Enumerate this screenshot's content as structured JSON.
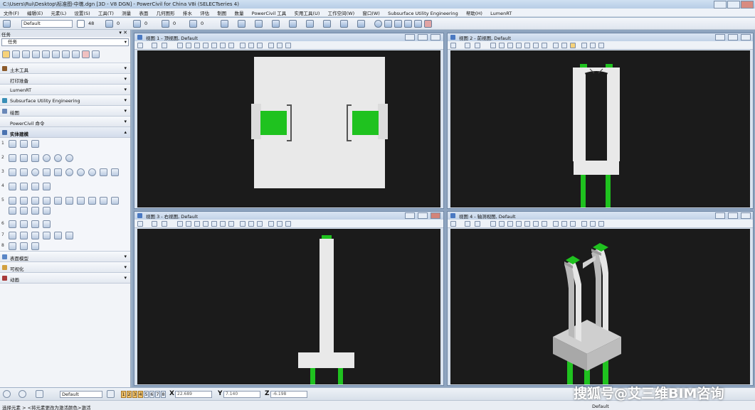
{
  "window": {
    "title": "C:\\Users\\Rui\\Desktop\\标准图-中墩.dgn [3D - V8 DGN] - PowerCivil for China V8i (SELECTseries 4)"
  },
  "menu": [
    "文件(F)",
    "编辑(E)",
    "元素(L)",
    "设置(S)",
    "工具(T)",
    "测量",
    "表面",
    "几何图形",
    "排水",
    "评估",
    "制图",
    "数量",
    "PowerCivil 工具",
    "实用工具(U)",
    "工作空间(W)",
    "窗口(W)",
    "Subsurface Utility Engineering",
    "帮助(H)",
    "LumenRT"
  ],
  "toolbar": {
    "level": "Default",
    "weight": "48",
    "style1": "0",
    "style2": "0",
    "style3": "0",
    "style4": "0"
  },
  "task_panel": {
    "title": "任务",
    "combo": "任务",
    "sections_top": [
      {
        "label": "土木工具",
        "icon": "civil-tools-icon"
      },
      {
        "label": "打印准备",
        "icon": "print-icon"
      },
      {
        "label": "LumenRT",
        "icon": "lumenrt-icon"
      },
      {
        "label": "Subsurface Utility Engineering",
        "icon": "sue-icon"
      },
      {
        "label": "绘图",
        "icon": "drawing-icon"
      },
      {
        "label": "PowerCivil 命令",
        "icon": "powercivil-icon"
      }
    ],
    "solid_section": {
      "label": "实体建模"
    },
    "solid_rows": [
      "1",
      "2",
      "3",
      "4",
      "5",
      "6",
      "7",
      "8"
    ],
    "sections_bottom": [
      {
        "label": "表面模型"
      },
      {
        "label": "可视化"
      },
      {
        "label": "动画"
      }
    ]
  },
  "views": [
    {
      "title": "视图 1 - 顶视图, Default"
    },
    {
      "title": "视图 2 - 前视图, Default"
    },
    {
      "title": "视图 3 - 右视图, Default"
    },
    {
      "title": "视图 4 - 轴测视图, Default"
    }
  ],
  "status": {
    "level": "Default",
    "view_numbers": [
      "1",
      "2",
      "3",
      "4",
      "5",
      "6",
      "7",
      "8"
    ],
    "x_label": "X",
    "x_value": "22.689",
    "y_label": "Y",
    "y_value": "7.140",
    "z_label": "Z",
    "z_value": "-6.198"
  },
  "prompt": {
    "text": "选择元素 > <将元素更改为激活颜色>激活",
    "active_level": "Default"
  },
  "watermark": "搜狐号@艾三维BIM咨询",
  "colors": {
    "canvas_bg": "#1b1b1b",
    "solid": "#e9e9e9",
    "accent_green": "#1fc21f",
    "iso_face_top": "#cfcfcf",
    "iso_face_side": "#a8a8a8"
  }
}
